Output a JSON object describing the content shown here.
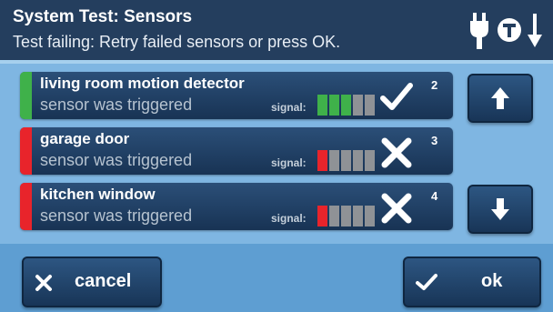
{
  "header": {
    "title": "System Test: Sensors",
    "subtitle": "Test failing: Retry failed sensors or press OK.",
    "icons": [
      "power-plug-icon",
      "test-mode-icon",
      "arrow-down-icon"
    ]
  },
  "signal_label": "signal:",
  "sensors": [
    {
      "name": "living room motion detector",
      "status": "sensor was triggered",
      "number": "2",
      "signal_level": 3,
      "signal_max": 5,
      "result": "pass"
    },
    {
      "name": "garage door",
      "status": "sensor was triggered",
      "number": "3",
      "signal_level": 1,
      "signal_max": 5,
      "result": "fail"
    },
    {
      "name": "kitchen window",
      "status": "sensor was triggered",
      "number": "4",
      "signal_level": 1,
      "signal_max": 5,
      "result": "fail"
    }
  ],
  "buttons": {
    "scroll_up": "scroll-up-icon",
    "scroll_down": "scroll-down-icon",
    "cancel": "cancel",
    "ok": "ok"
  },
  "colors": {
    "pass": "#3fb14a",
    "fail": "#e8242b",
    "signal_off": "#8f9296",
    "header_bg": "#243e5e",
    "panel_bg": "#7fb6e2"
  }
}
